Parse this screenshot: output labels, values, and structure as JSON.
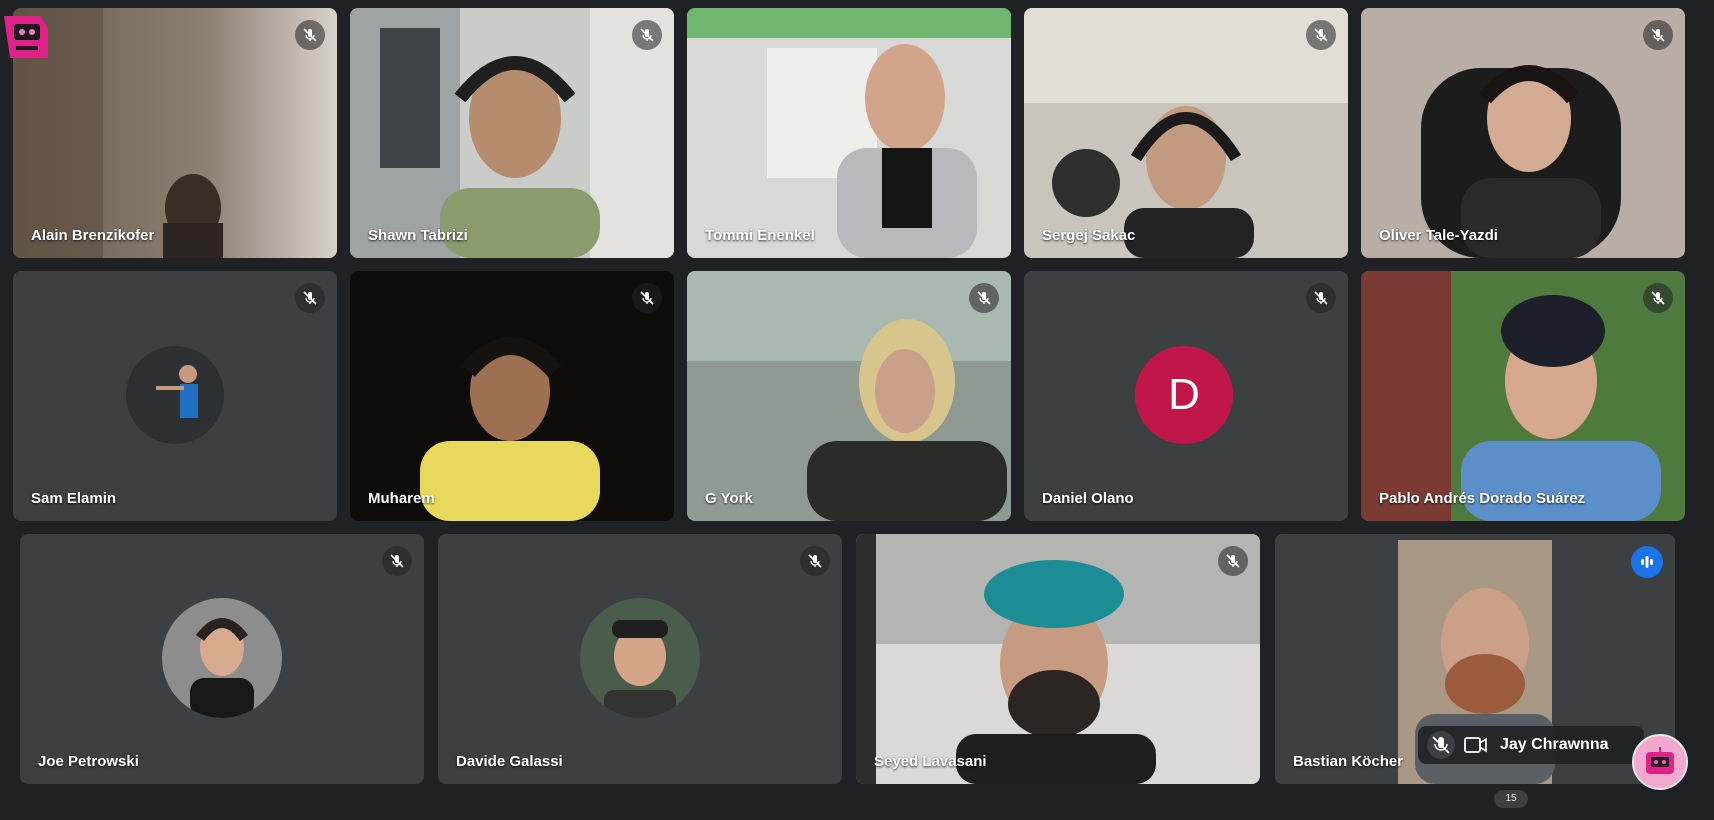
{
  "participants": [
    {
      "name": "Alain Brenzikofer"
    },
    {
      "name": "Shawn Tabrizi"
    },
    {
      "name": "Tommi Enenkel"
    },
    {
      "name": "Sergej Sakac"
    },
    {
      "name": "Oliver Tale-Yazdi"
    },
    {
      "name": "Sam Elamin"
    },
    {
      "name": "Muharem"
    },
    {
      "name": "G York"
    },
    {
      "name": "Daniel Olano",
      "initial": "D"
    },
    {
      "name": "Pablo Andrés Dorado Suárez"
    },
    {
      "name": "Joe Petrowski"
    },
    {
      "name": "Davide Galassi"
    },
    {
      "name": "Seyed Lavasani"
    },
    {
      "name": "Bastian Köcher"
    }
  ],
  "self_view": {
    "name": "Jay Chrawnna"
  },
  "overflow_count": "15",
  "icons": {
    "mute": "mic-off-icon",
    "speaking": "audio-level-icon",
    "camera": "camera-icon",
    "logo": "robot-sticker-icon"
  },
  "colors": {
    "accent": "#1a73e8",
    "active_border": "#5f96ee",
    "avatar_d": "#c1164a"
  }
}
